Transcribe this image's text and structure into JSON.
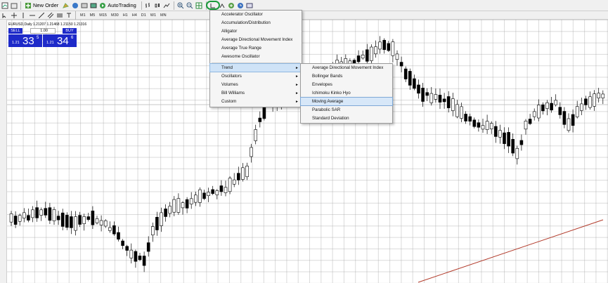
{
  "toolbar": {
    "new_order_label": "New Order",
    "autotrading_label": "AutoTrading",
    "timeframes": [
      "M1",
      "M5",
      "M15",
      "M30",
      "H1",
      "H4",
      "D1",
      "W1",
      "MN"
    ]
  },
  "chart": {
    "symbol_info": "EURUSD,Daily  1.21207 1.21468 1.21150 1.21316"
  },
  "trade_panel": {
    "sell_label": "SELL",
    "buy_label": "BUY",
    "lot_value": "1.00",
    "sell_price_prefix": "1.21",
    "sell_price_big": "33",
    "sell_price_sup": "5",
    "buy_price_prefix": "1.21",
    "buy_price_big": "34",
    "buy_price_sup": "6"
  },
  "indicators_menu": {
    "items": [
      "Accelerator Oscillator",
      "Accumulation/Distribution",
      "Alligator",
      "Average Directional Movement Index",
      "Average True Range",
      "Awesome Oscillator"
    ],
    "groups": [
      "Trend",
      "Oscillators",
      "Volumes",
      "Bill Williams",
      "Custom"
    ]
  },
  "trend_submenu": {
    "items": [
      "Average Directional Movement Index",
      "Bollinger Bands",
      "Envelopes",
      "Ichimoku Kinko Hyo",
      "Moving Average",
      "Parabolic SAR",
      "Standard Deviation"
    ],
    "selected": "Moving Average"
  },
  "colors": {
    "accent": "#1e2ac9",
    "highlight": "#1a9a3a",
    "trendline": "#b23a2a"
  }
}
